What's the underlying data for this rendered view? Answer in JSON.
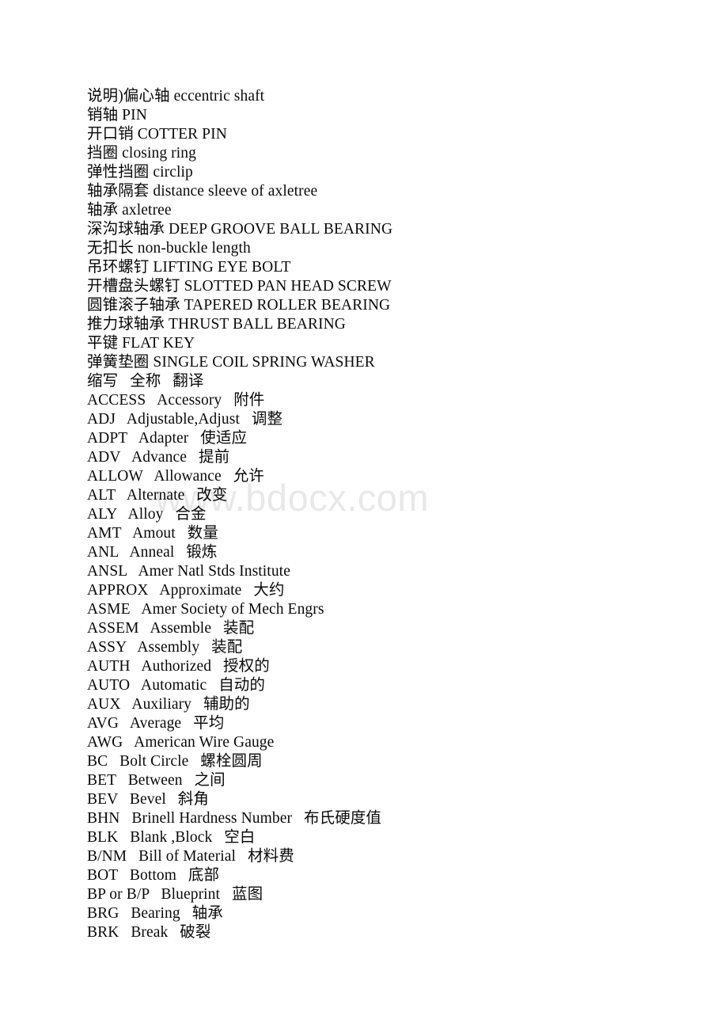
{
  "document": {
    "watermark": "www.bdocx.com",
    "background_color": "#ffffff",
    "text_color": "#0a0a0a",
    "watermark_color": "#e8e8e8",
    "glossary_header": "缩写   全称   翻译",
    "terms": [
      "说明)偏心轴 eccentric shaft",
      "销轴 PIN",
      "开口销 COTTER PIN",
      "挡圈 closing ring",
      "弹性挡圈 circlip",
      "轴承隔套 distance sleeve of axletree",
      "轴承 axletree",
      "深沟球轴承 DEEP GROOVE BALL BEARING",
      "无扣长 non-buckle length",
      "吊环螺钉 LIFTING EYE BOLT",
      "开槽盘头螺钉 SLOTTED PAN HEAD SCREW",
      "圆锥滚子轴承 TAPERED ROLLER BEARING",
      "推力球轴承 THRUST BALL BEARING",
      "平键 FLAT KEY",
      "弹簧垫圈 SINGLE COIL SPRING WASHER"
    ],
    "abbreviations": [
      "ACCESS   Accessory   附件",
      "ADJ   Adjustable,Adjust   调整",
      "ADPT   Adapter   使适应",
      "ADV   Advance   提前",
      "ALLOW   Allowance   允许",
      "ALT   Alternate   改变",
      "ALY   Alloy   合金",
      "AMT   Amout   数量",
      "ANL   Anneal   锻炼",
      "ANSL   Amer Natl Stds Institute",
      "APPROX   Approximate   大约",
      "ASME   Amer Society of Mech Engrs",
      "ASSEM   Assemble   装配",
      "ASSY   Assembly   装配",
      "AUTH   Authorized   授权的",
      "AUTO   Automatic   自动的",
      "AUX   Auxiliary   辅助的",
      "AVG   Average   平均",
      "AWG   American Wire Gauge",
      "BC   Bolt Circle   螺栓圆周",
      "BET   Between   之间",
      "BEV   Bevel   斜角",
      "BHN   Brinell Hardness Number   布氏硬度值",
      "BLK   Blank ,Block   空白",
      "B/NM   Bill of Material   材料费",
      "BOT   Bottom   底部",
      "BP or B/P   Blueprint   蓝图",
      "BRG   Bearing   轴承",
      "BRK   Break   破裂"
    ]
  }
}
